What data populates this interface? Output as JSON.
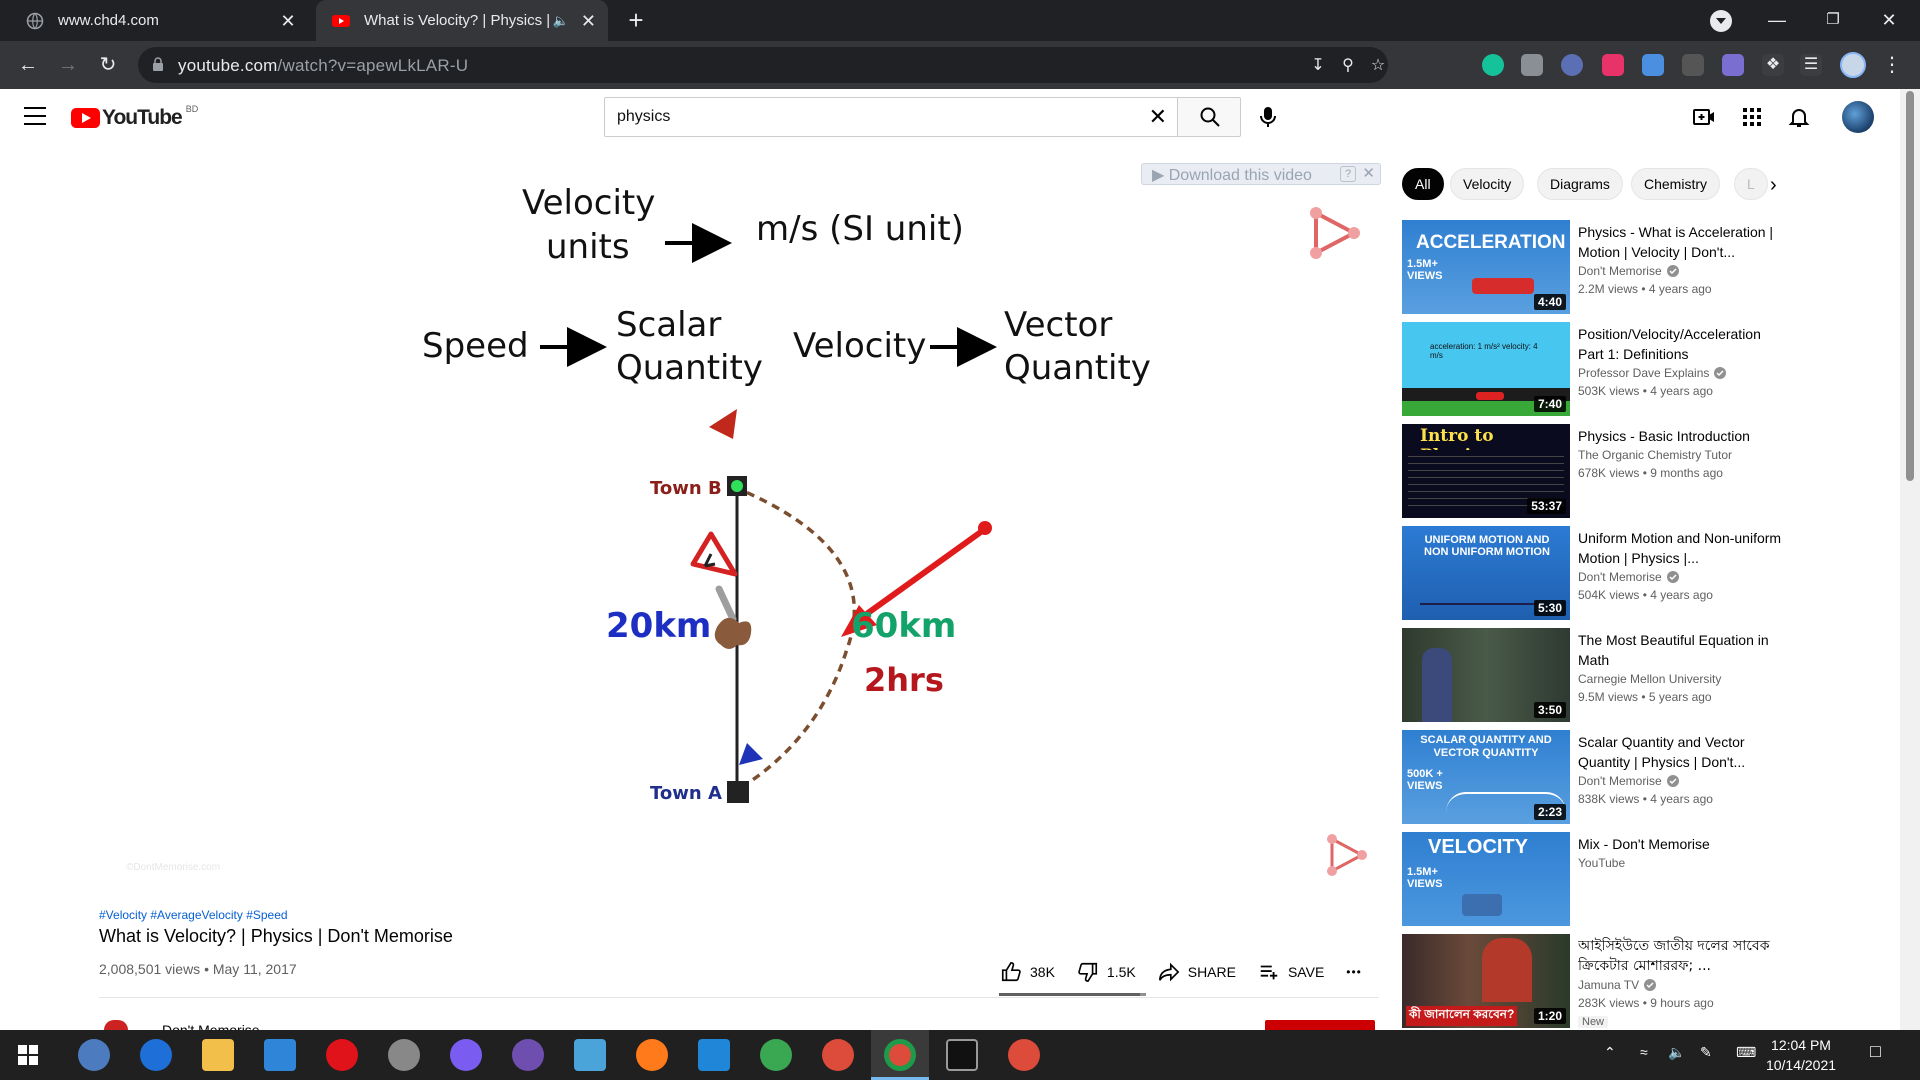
{
  "browser": {
    "tabs": [
      {
        "title": "www.chd4.com",
        "active": false,
        "icon": "globe-icon"
      },
      {
        "title": "What is Velocity? | Physics | Don't Memorise - YouTube",
        "active": true,
        "icon": "youtube-icon",
        "audio": "mute-icon"
      }
    ],
    "url_host": "youtube.com",
    "url_path": "/watch?v=apewLkLAR-U",
    "window_controls": {
      "minimize": "—",
      "maximize": "❐",
      "close": "✕"
    }
  },
  "youtube": {
    "logo_text": "YouTube",
    "country_code": "BD",
    "search_query": "physics",
    "video": {
      "slide": {
        "line1_left": [
          "Velocity",
          "units"
        ],
        "line1_right": "m/s  (SI unit)",
        "speed": "Speed",
        "scalar": [
          "Scalar",
          "Quantity"
        ],
        "velocity": "Velocity",
        "vector": [
          "Vector",
          "Quantity"
        ],
        "town_b": "Town B",
        "town_a": "Town A",
        "dist_straight": "20km",
        "dist_curve": "60km",
        "time": "2hrs"
      },
      "download_label": "Download this video",
      "download_help": "?",
      "watermark": "©DontMemorise.com",
      "hashtags": "#Velocity #AverageVelocity #Speed",
      "title": "What is Velocity? | Physics | Don't Memorise",
      "meta": "2,008,501 views • May 11, 2017",
      "likes": "38K",
      "dislikes": "1.5K",
      "like_ratio": 0.96,
      "share_label": "SHARE",
      "save_label": "SAVE",
      "more_label": "•••",
      "channel_peek": "Don't Memorise"
    },
    "chips": [
      "All",
      "Velocity",
      "Diagrams",
      "Chemistry",
      "L"
    ],
    "recommendations": [
      {
        "title": "Physics - What is Acceleration | Motion | Velocity | Don't...",
        "channel": "Don't Memorise",
        "verified": true,
        "meta": "2.2M views • 4 years ago",
        "duration": "4:40",
        "thumb_text": "ACCELERATION",
        "thumb_sub": "1.5M+ VIEWS"
      },
      {
        "title": "Position/Velocity/Acceleration Part 1: Definitions",
        "channel": "Professor Dave Explains",
        "verified": true,
        "meta": "503K views • 4 years ago",
        "duration": "7:40",
        "thumb_text": "acceleration: 1 m/s²   velocity: 4 m/s"
      },
      {
        "title": "Physics - Basic Introduction",
        "channel": "The Organic Chemistry Tutor",
        "verified": false,
        "meta": "678K views • 9 months ago",
        "duration": "53:37",
        "thumb_text": "Intro to Physics"
      },
      {
        "title": "Uniform Motion and Non-uniform Motion | Physics |...",
        "channel": "Don't Memorise",
        "verified": true,
        "meta": "504K views • 4 years ago",
        "duration": "5:30",
        "thumb_text": "UNIFORM MOTION AND NON UNIFORM MOTION"
      },
      {
        "title": "The Most Beautiful Equation in Math",
        "channel": "Carnegie Mellon University",
        "verified": false,
        "meta": "9.5M views • 5 years ago",
        "duration": "3:50"
      },
      {
        "title": "Scalar Quantity and Vector Quantity | Physics | Don't...",
        "channel": "Don't Memorise",
        "verified": true,
        "meta": "838K views • 4 years ago",
        "duration": "2:23",
        "thumb_text": "SCALAR QUANTITY AND VECTOR QUANTITY",
        "thumb_sub": "500K + VIEWS"
      },
      {
        "title": "Mix - Don't Memorise",
        "channel": "YouTube",
        "verified": false,
        "meta": "",
        "duration": "",
        "thumb_text": "VELOCITY",
        "thumb_sub": "1.5M+ VIEWS"
      },
      {
        "title": "আইসিইউতে জাতীয় দলের সাবেক ক্রিকেটার মোশাররফ; ...",
        "channel": "Jamuna TV",
        "verified": true,
        "meta": "283K views • 9 hours ago",
        "duration": "1:20",
        "badge": "New",
        "thumb_text": "কী জানালেন করবেন?"
      }
    ]
  },
  "taskbar": {
    "time": "12:04 PM",
    "date": "10/14/2021"
  },
  "colors": {
    "yt_red": "#ff0000",
    "link_blue": "#065fd4",
    "chrome_dark": "#202124",
    "chrome_toolbar": "#35363a"
  }
}
